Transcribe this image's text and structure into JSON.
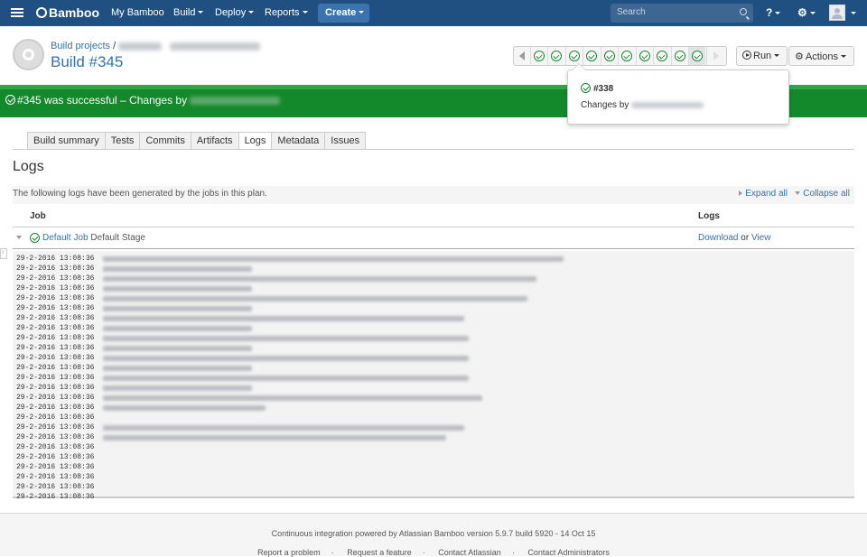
{
  "header": {
    "logo": "Bamboo",
    "nav": [
      "My Bamboo",
      "Build",
      "Deploy",
      "Reports"
    ],
    "create": "Create",
    "search_placeholder": "Search"
  },
  "page": {
    "breadcrumb_root": "Build projects",
    "breadcrumb_sep": "/",
    "title": "Build #345",
    "run": "Run",
    "actions": "Actions"
  },
  "banner": {
    "text": "#345 was successful – Changes by"
  },
  "popup": {
    "build": "#338",
    "changes": "Changes by"
  },
  "tabs": [
    "Build summary",
    "Tests",
    "Commits",
    "Artifacts",
    "Logs",
    "Metadata",
    "Issues"
  ],
  "active_tab": "Logs",
  "logs": {
    "heading": "Logs",
    "info": "The following logs have been generated by the jobs in this plan.",
    "expand_all": "Expand all",
    "collapse_all": "Collapse all",
    "col_job": "Job",
    "col_logs": "Logs",
    "job_name": "Default Job",
    "job_stage": "Default Stage",
    "download": "Download",
    "or": "or",
    "view": "View",
    "timestamp": "29-2-2016 13:08:36",
    "line_count": 25
  },
  "footer": {
    "powered": "Continuous integration powered by Atlassian Bamboo version 5.9.7 build 5920 - 14 Oct 15",
    "links": [
      "Report a problem",
      "Request a feature",
      "Contact Atlassian",
      "Contact Administrators"
    ],
    "sep": "·"
  },
  "colors": {
    "header": "#205081",
    "success": "#14892c",
    "link": "#3572b0"
  }
}
